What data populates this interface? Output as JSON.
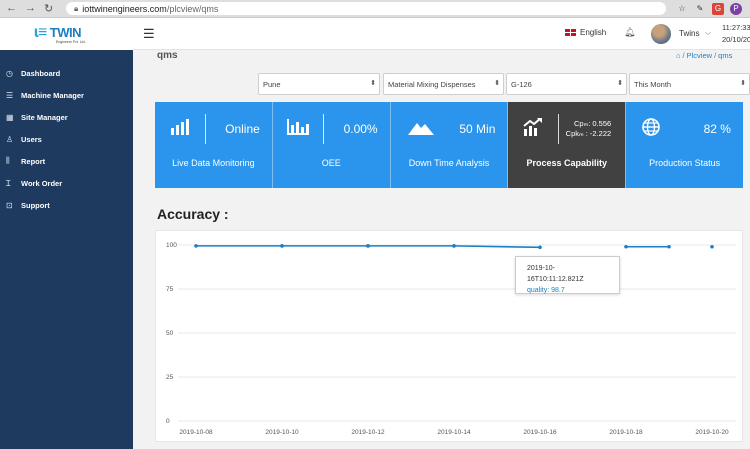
{
  "browser": {
    "url_host": "iottwinengineers.com",
    "url_path": "/plcview/qms"
  },
  "brand": {
    "logo_text": "TWIN",
    "logo_subtext": "Engineers Pvt. Ltd."
  },
  "sidebar": {
    "items": [
      {
        "label": "Dashboard",
        "icon": "clock-icon"
      },
      {
        "label": "Machine Manager",
        "icon": "list-icon"
      },
      {
        "label": "Site Manager",
        "icon": "grid-icon"
      },
      {
        "label": "Users",
        "icon": "user-icon"
      },
      {
        "label": "Report",
        "icon": "bar-chart-icon"
      },
      {
        "label": "Work Order",
        "icon": "text-cursor-icon"
      },
      {
        "label": "Support",
        "icon": "inbox-icon"
      }
    ]
  },
  "header": {
    "language": "English",
    "username": "Twins",
    "time": "11:27:33",
    "date": "20/10/20"
  },
  "page": {
    "title": "qms",
    "breadcrumb": [
      "Plcview",
      "qms"
    ]
  },
  "filters": {
    "location": "Pune",
    "machine": "Material Mixing Dispenses",
    "device": "G-126",
    "period": "This Month"
  },
  "cards": [
    {
      "value": "Online",
      "label": "Live Data Monitoring",
      "icon": "signal-bars-icon"
    },
    {
      "value": "0.00%",
      "label": "OEE",
      "icon": "bar-chart-icon"
    },
    {
      "value": "50 Min",
      "label": "Down Time Analysis",
      "icon": "mountain-icon"
    },
    {
      "cpm": "Cpₘ: 0.556",
      "cpkm": "Cpkₘ : -2.222",
      "label": "Process Capability",
      "icon": "trend-up-icon"
    },
    {
      "value": "82 %",
      "label": "Production Status",
      "icon": "globe-icon"
    }
  ],
  "accuracy": {
    "title": "Accuracy :",
    "tooltip": {
      "timestamp": "2019-10-16T10:11:12.821Z",
      "text": "quality: 98.7"
    }
  },
  "chart_data": {
    "type": "line",
    "title": "Accuracy :",
    "xlabel": "",
    "ylabel": "",
    "ylim": [
      0,
      100
    ],
    "yticks": [
      0,
      25,
      50,
      75,
      100
    ],
    "xticks": [
      "2019-10-08",
      "2019-10-10",
      "2019-10-12",
      "2019-10-14",
      "2019-10-16",
      "2019-10-18",
      "2019-10-20"
    ],
    "series": [
      {
        "name": "quality",
        "color": "#1d7fc3",
        "segments": [
          [
            {
              "x": "2019-10-08",
              "y": 99.5
            },
            {
              "x": "2019-10-10",
              "y": 99.5
            }
          ],
          [
            {
              "x": "2019-10-10",
              "y": 99.5
            },
            {
              "x": "2019-10-12",
              "y": 99.5
            }
          ],
          [
            {
              "x": "2019-10-12",
              "y": 99.5
            },
            {
              "x": "2019-10-14",
              "y": 99.5
            }
          ],
          [
            {
              "x": "2019-10-14",
              "y": 99.5
            },
            {
              "x": "2019-10-16",
              "y": 98.7
            }
          ],
          [
            {
              "x": "2019-10-18",
              "y": 99.0
            },
            {
              "x": "2019-10-19",
              "y": 99.0
            }
          ],
          [
            {
              "x": "2019-10-20",
              "y": 99.0
            }
          ]
        ]
      }
    ]
  }
}
